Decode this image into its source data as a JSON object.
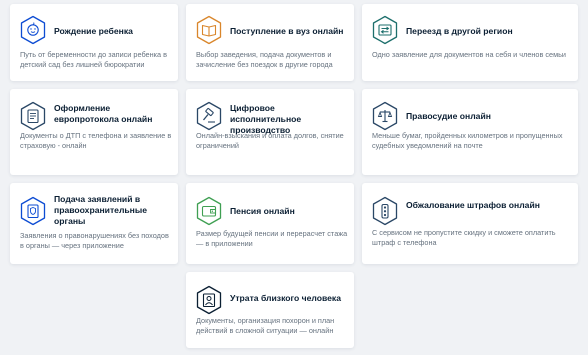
{
  "colors": {
    "accent_blue": "#0d4cd3",
    "accent_orange": "#d9862b",
    "accent_teal": "#1d6f6c",
    "accent_navy": "#2a4766",
    "accent_green": "#3f9f52",
    "background": "#f0f2f5"
  },
  "cards": [
    {
      "title": "Рождение ребенка",
      "desc": "Путь от беременности до записи ребенка в детский сад без лишней бюрократии",
      "icon": "baby-icon"
    },
    {
      "title": "Поступление в вуз онлайн",
      "desc": "Выбор заведения, подача документов и зачисление без поездок в другие города",
      "icon": "book-icon"
    },
    {
      "title": "Переезд в другой регион",
      "desc": "Одно заявление для документов на себя и членов семьи",
      "icon": "relocation-icon"
    },
    {
      "title": "Оформление европротокола онлайн",
      "desc": "Документы о ДТП с телефона и заявление в страховую - онлайн",
      "icon": "protocol-icon"
    },
    {
      "title": "Цифровое исполнительное производство",
      "desc": "Онлайн-взыскания и оплата долгов, снятие ограничений",
      "icon": "gavel-icon"
    },
    {
      "title": "Правосудие онлайн",
      "desc": "Меньше бумаг, пройденных километров и пропущенных судебных уведомлений на почте",
      "icon": "scales-icon"
    },
    {
      "title": "Подача заявлений в правоохранительные органы",
      "desc": "Заявления о правонарушениях без походов в органы — через приложение",
      "icon": "badge-icon"
    },
    {
      "title": "Пенсия онлайн",
      "desc": "Размер будущей пенсии и перерасчет стажа — в приложении",
      "icon": "wallet-icon"
    },
    {
      "title": "Обжалование штрафов онлайн",
      "desc": "С сервисом не пропустите скидку и сможете оплатить штраф с телефона",
      "icon": "traffic-light-icon"
    },
    {
      "title": "Утрата близкого человека",
      "desc": "Документы, организация похорон и план действий в сложной ситуации — онлайн",
      "icon": "portrait-icon"
    }
  ]
}
